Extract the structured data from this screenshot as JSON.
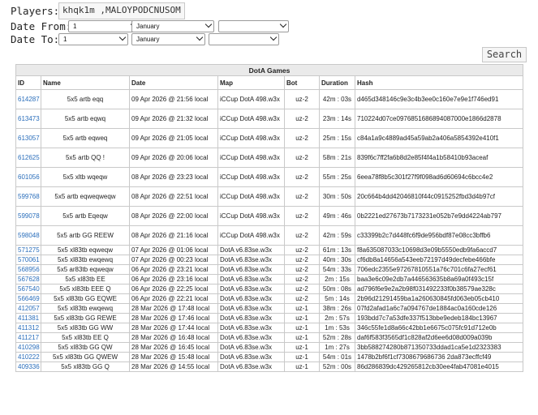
{
  "filters": {
    "players_label": "Players:",
    "players_value": "khqk1m ,MALOYPODCNUSOM",
    "date_from_label": "Date From:",
    "date_to_label": "Date To:",
    "from_day": "1",
    "from_month": "January",
    "from_year": "",
    "to_day": "1",
    "to_month": "January",
    "to_year": "",
    "search_label": "Search"
  },
  "table": {
    "caption": "DotA Games",
    "columns": [
      "ID",
      "Name",
      "Date",
      "Map",
      "Bot",
      "Duration",
      "Hash"
    ],
    "rows": [
      [
        "614287",
        "5x5 artb eqq",
        "09 Apr 2026 @ 21:56 local",
        "iCCup DotA 498.w3x",
        "uz-2",
        "42m : 03s",
        "d465d348146c9e3c4b3ee0c160e7e9e1f746ed91"
      ],
      [
        "613473",
        "5x5 artb eqwq",
        "09 Apr 2026 @ 21:32 local",
        "iCCup DotA 498.w3x",
        "uz-2",
        "23m : 14s",
        "710224d07ce0976851686894087000e1866d2878"
      ],
      [
        "613057",
        "5x5 artb eqweq",
        "09 Apr 2026 @ 21:05 local",
        "iCCup DotA 498.w3x",
        "uz-2",
        "25m : 15s",
        "c84a1a9c4889ad45a59ab2a406a5854392e410f1"
      ],
      [
        "612625",
        "5x5 artb QQ !",
        "09 Apr 2026 @ 20:06 local",
        "iCCup DotA 498.w3x",
        "uz-2",
        "58m : 21s",
        "839f6c7ff2fa6b8d2e85f4f4a1b58410b93aceaf"
      ],
      [
        "601056",
        "5x5 xltb wqeqw",
        "08 Apr 2026 @ 23:23 local",
        "iCCup DotA 498.w3x",
        "uz-2",
        "55m : 25s",
        "6eea78f8b5c301f27f9f098ad6d60694c6bcc4e2"
      ],
      [
        "599768",
        "5x5 artb eqweqweqw",
        "08 Apr 2026 @ 22:51 local",
        "iCCup DotA 498.w3x",
        "uz-2",
        "30m : 50s",
        "20c664b4dd42046810f44c0915252fbd3d4b97cf"
      ],
      [
        "599078",
        "5x5 artb Eqeqw",
        "08 Apr 2026 @ 22:00 local",
        "iCCup DotA 498.w3x",
        "uz-2",
        "49m : 46s",
        "0b2221ed27673b7173231e052b7e9dd4224ab797"
      ],
      [
        "598048",
        "5x5 artb GG REEW",
        "08 Apr 2026 @ 21:16 local",
        "iCCup DotA 498.w3x",
        "uz-2",
        "42m : 59s",
        "c33399b2c7d448fc6f9de956bdf87e08cc3bffb6"
      ],
      [
        "571275",
        "5x5 xl83tb eqweqw",
        "07 Apr 2026 @ 01:06 local",
        "DotA v6.83se.w3x",
        "uz-2",
        "61m : 13s",
        "f8a635087033c10698d3e09b5550edb9fa6accd7"
      ],
      [
        "570061",
        "5x5 xl83tb ewqewq",
        "07 Apr 2026 @ 00:23 local",
        "DotA v6.83se.w3x",
        "uz-2",
        "40m : 30s",
        "cf6db8a14656a543eeb72197d49decfebe466bfe"
      ],
      [
        "568956",
        "5x5 ar83tb eqweqw",
        "06 Apr 2026 @ 23:21 local",
        "DotA v6.83se.w3x",
        "uz-2",
        "54m : 33s",
        "706edc2355e97267810551a76c701c6fa27ecf61"
      ],
      [
        "567628",
        "5x5 xl83tb EE",
        "06 Apr 2026 @ 23:16 local",
        "DotA v6.83se.w3x",
        "uz-2",
        "2m : 15s",
        "baa3e6c09e2db7a446563635b8a69a0f493c15f"
      ],
      [
        "567540",
        "5x5 xl83tb EEE Q",
        "06 Apr 2026 @ 22:25 local",
        "DotA v6.83se.w3x",
        "uz-2",
        "50m : 08s",
        "ad796f6e9e2a2b98f031492233f0b38579ae328c"
      ],
      [
        "566469",
        "5x5 xl83tb GG EQWE",
        "06 Apr 2026 @ 22:21 local",
        "DotA v6.83se.w3x",
        "uz-2",
        "5m : 14s",
        "2b96d21291459ba1a260630845fd063eb05cb410"
      ],
      [
        "412057",
        "5x5 xl83tb ewqewq",
        "28 Mar 2026 @ 17:48 local",
        "DotA v6.83se.w3x",
        "uz-1",
        "38m : 26s",
        "07fd2afad1a6c7a094767de1884ac0a160cde126"
      ],
      [
        "411381",
        "5x5 xl83tb GG REWE",
        "28 Mar 2026 @ 17:46 local",
        "DotA v6.83se.w3x",
        "uz-1",
        "2m : 57s",
        "193bdd7c7a53dfe337f513bbe9edeb184bc13967"
      ],
      [
        "411312",
        "5x5 xl83tb GG WW",
        "28 Mar 2026 @ 17:44 local",
        "DotA v6.83se.w3x",
        "uz-1",
        "1m : 53s",
        "346c55fe1d8a66c42bb1e6675c075fc91d712e0b"
      ],
      [
        "411217",
        "5x5 xl83tb EE Q",
        "28 Mar 2026 @ 16:48 local",
        "DotA v6.83se.w3x",
        "uz-1",
        "52m : 28s",
        "daf6f583f3565df1c828af2d6ee6d08d009a039b"
      ],
      [
        "410298",
        "5x5 xl83tb GG QW",
        "28 Mar 2026 @ 16:45 local",
        "DotA v6.83se.w3x",
        "uz-1",
        "1m : 27s",
        "3bb588274280b871350733ddad1ca5e1d2323383"
      ],
      [
        "410222",
        "5x5 xl83tb GG QWEW",
        "28 Mar 2026 @ 15:48 local",
        "DotA v6.83se.w3x",
        "uz-1",
        "54m : 01s",
        "1478b2bf6f1cf7308679686736 2da873ecffcf49"
      ],
      [
        "409336",
        "5x5 xl83tb GG Q",
        "28 Mar 2026 @ 14:55 local",
        "DotA v6.83se.w3x",
        "uz-1",
        "52m : 00s",
        "86d286839dc429265812cb30ee4fab47081e4015"
      ]
    ]
  },
  "colors": {
    "link": "#2a6ebb",
    "caption_bg": "#eaeaea",
    "border": "#c9c9c9"
  }
}
